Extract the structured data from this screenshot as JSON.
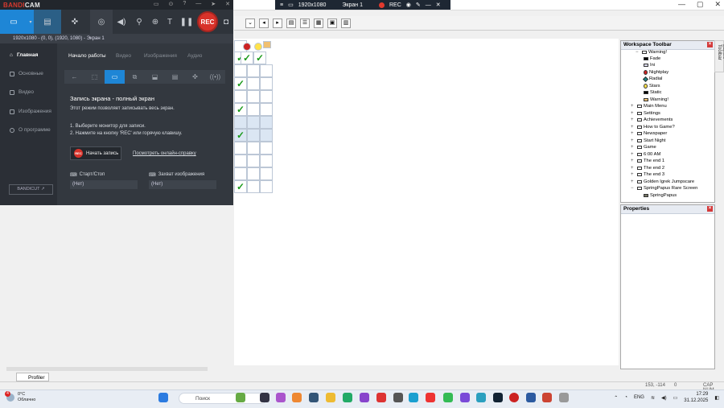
{
  "recording_banner": {
    "resolution": "1920x1080",
    "screen": "Экран 1",
    "rec_label": "REC"
  },
  "editor": {
    "toolbar_icons": [
      "arrow-left-icon",
      "arrow-right-icon",
      "layout-icon",
      "list-icon",
      "grid-icon"
    ]
  },
  "workspace": {
    "title": "Workspace Toolbar",
    "items": [
      "Warning!",
      "Fade",
      "Ini",
      "Nightplay",
      "Radial",
      "Stars",
      "Static",
      "Warning!",
      "Main Menu",
      "Settings",
      "Achievements",
      "How to Game?",
      "Newspaper",
      "Start Night",
      "Game",
      "6:00 AM",
      "The end 1",
      "The end 2",
      "The end 3",
      "Golden Igrek Jumpscare",
      "SpringPapus Rare Screen",
      "SpringPapus"
    ]
  },
  "properties": {
    "title": "Properties"
  },
  "layers_tab": {
    "label": "Layers Toolbar"
  },
  "bandicam": {
    "logo_a": "BANDI",
    "logo_b": "CAM",
    "info_line": "1920x1080 - (0, 0), (1920, 1080) - Экран 1",
    "rec_button": "REC",
    "sidebar": [
      "Главная",
      "Основные",
      "Видео",
      "Изображения",
      "О программе"
    ],
    "bandicut_label": "BANDICUT ↗",
    "tabs": [
      "Начало работы",
      "Видео",
      "Изображения",
      "Аудио"
    ],
    "mode_title": "Запись экрана - полный экран",
    "mode_desc": "Этот режим позволяет записывать весь экран.",
    "step1": "1. Выберите монитор для записи.",
    "step2": "2. Нажмите на кнопку 'REC' или горячую клавишу.",
    "start_button": "Начать запись",
    "mini_rec": "REC",
    "help_link": "Посмотреть онлайн-справку",
    "hotkey1_label": "Старт/Стоп",
    "hotkey1_value": "(Нет)",
    "hotkey2_label": "Захват изображения",
    "hotkey2_value": "(Нет)"
  },
  "bottom": {
    "profiler_tab": "Profiler",
    "coords": "153, -114",
    "zero": "0",
    "caps": "CAP NUM"
  },
  "taskbar": {
    "temp": "0°C",
    "weather": "Облачно",
    "badge": "4",
    "search_placeholder": "Поиск",
    "lang": "ENG",
    "time": "17:29",
    "date": "31.12.2025"
  },
  "colors": {
    "accent": "#1e86d6",
    "rec_red": "#d8322a",
    "bandicam_bg": "#2b2f36"
  }
}
